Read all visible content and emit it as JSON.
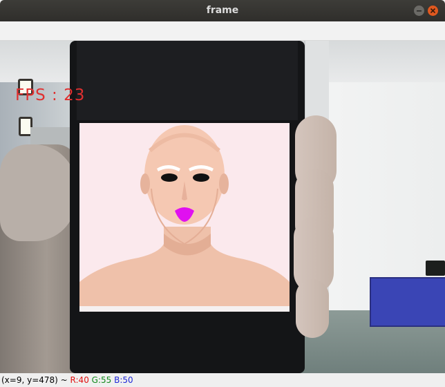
{
  "window": {
    "title": "frame",
    "buttons": [
      "minimize-icon",
      "close-icon"
    ],
    "colors": {
      "titlebar": "#2f2e2b",
      "close": "#e0581f"
    }
  },
  "overlay": {
    "fps_text": "FPS : 23",
    "color": "#e03030"
  },
  "status": {
    "coords": "(x=9, y=478) ~",
    "r": "R:40",
    "g": "G:55",
    "b": "B:50",
    "colors": {
      "r": "#e01010",
      "g": "#11891b",
      "b": "#1d26d8"
    }
  },
  "face": {
    "lip_color": "#e010f0",
    "eyebrow_color": "#ffffff"
  }
}
